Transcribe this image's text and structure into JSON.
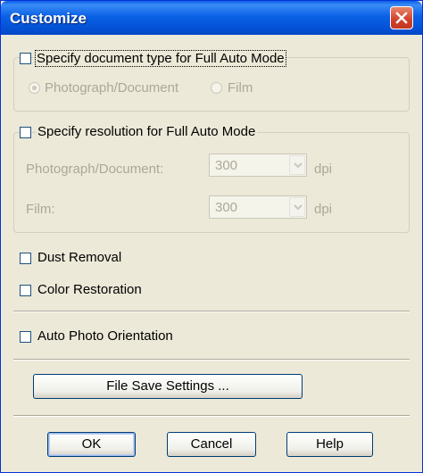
{
  "window": {
    "title": "Customize"
  },
  "doc_type": {
    "checkbox_label": "Specify document type for Full Auto Mode",
    "radio_photo": "Photograph/Document",
    "radio_film": "Film",
    "selected": "Photograph/Document"
  },
  "resolution": {
    "checkbox_label": "Specify resolution for Full Auto Mode",
    "photo_label": "Photograph/Document:",
    "photo_value": "300",
    "film_label": "Film:",
    "film_value": "300",
    "unit": "dpi"
  },
  "options": {
    "dust_removal": "Dust Removal",
    "color_restoration": "Color Restoration",
    "auto_orientation": "Auto Photo Orientation"
  },
  "buttons": {
    "file_save": "File Save Settings ...",
    "ok": "OK",
    "cancel": "Cancel",
    "help": "Help"
  }
}
